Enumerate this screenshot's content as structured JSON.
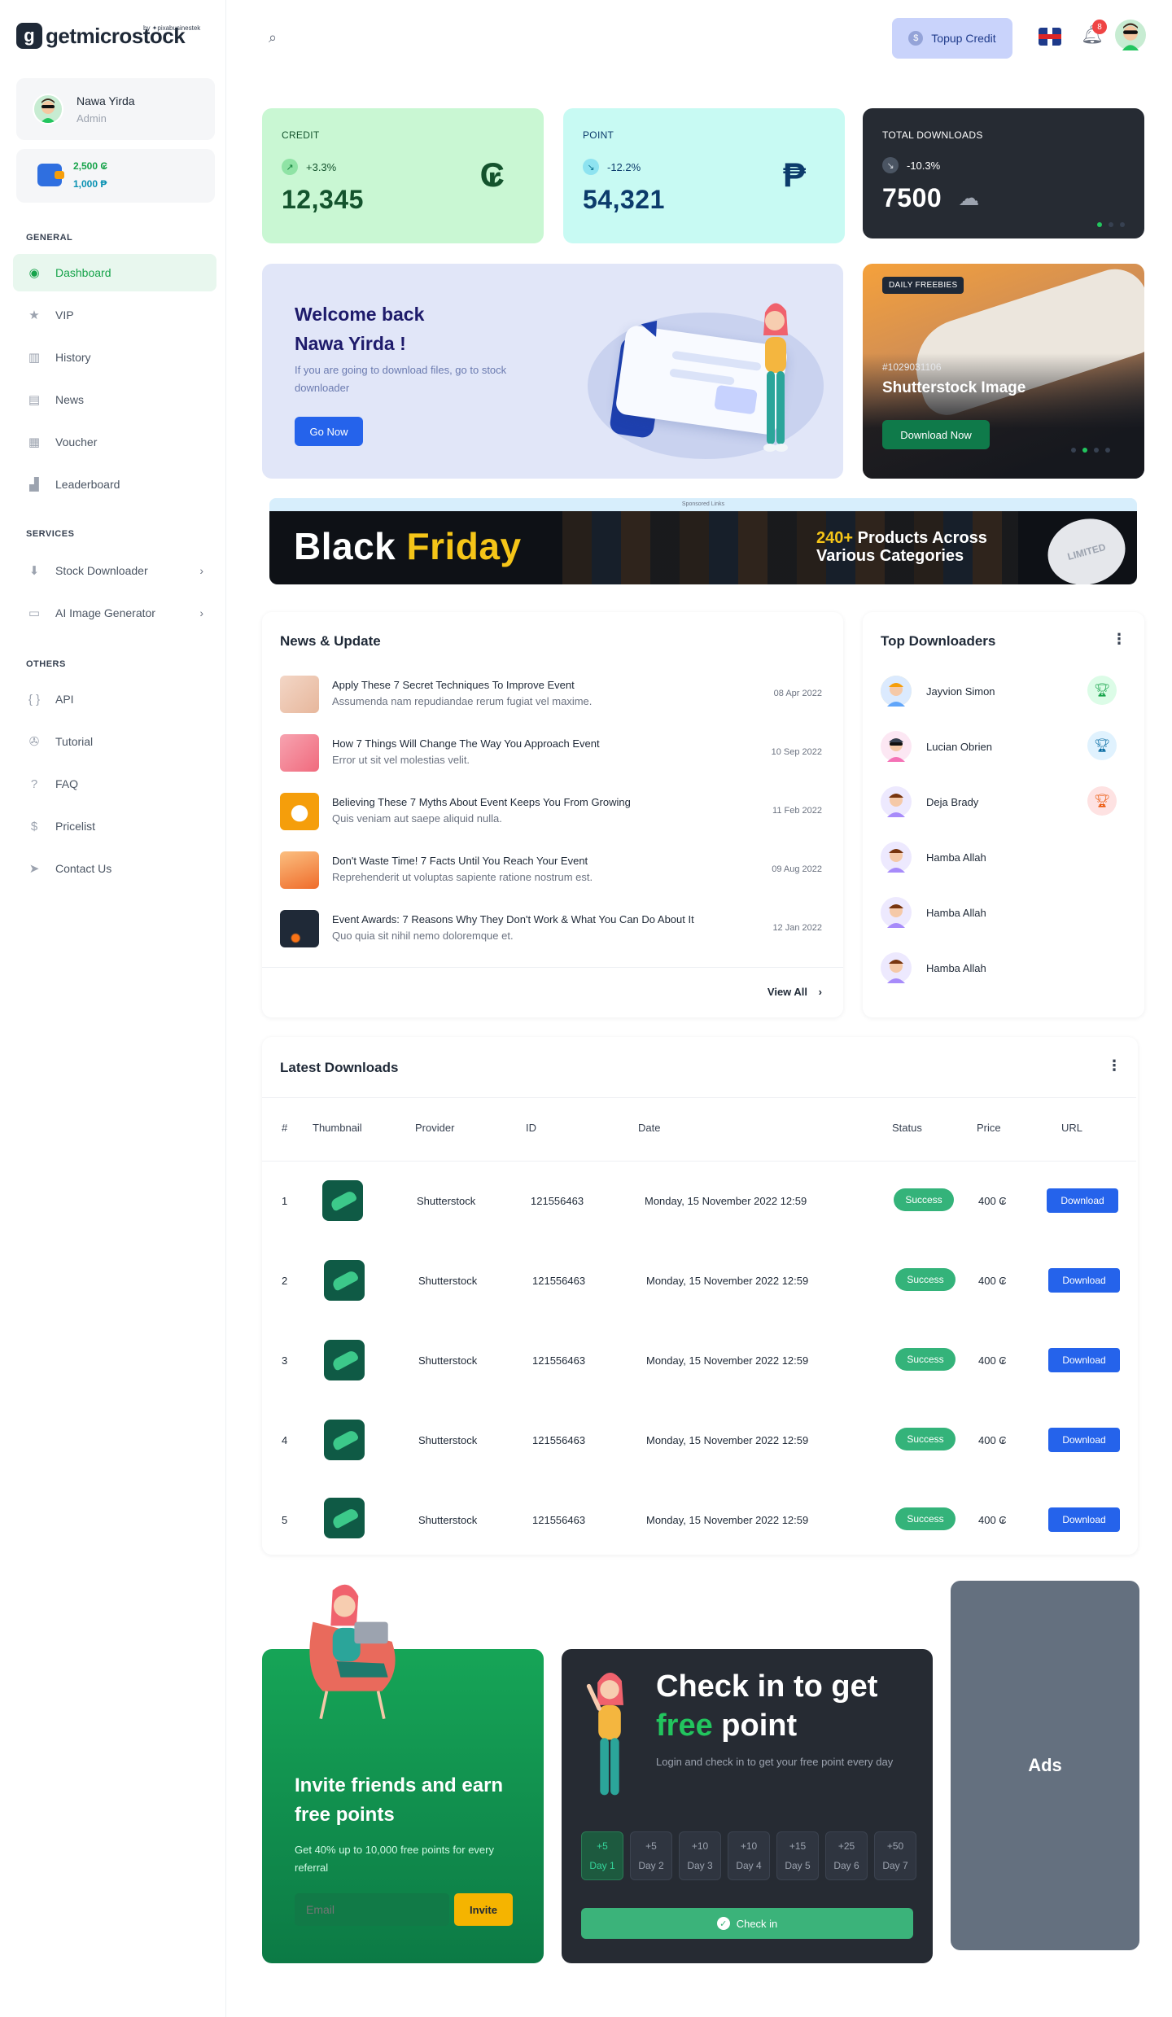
{
  "brand": {
    "name": "getmicrostock",
    "mark": "g",
    "by": "by ✦pixabusinestek"
  },
  "user": {
    "name": "Nawa Yirda",
    "role": "Admin"
  },
  "wallet": {
    "credit": "2,500 ₢",
    "point": "1,000 ₱"
  },
  "sidebar": {
    "general_heading": "GENERAL",
    "general": [
      {
        "label": "Dashboard",
        "icon": "dashboard-icon",
        "active": true
      },
      {
        "label": "VIP",
        "icon": "star-icon"
      },
      {
        "label": "History",
        "icon": "chart-icon"
      },
      {
        "label": "News",
        "icon": "document-icon"
      },
      {
        "label": "Voucher",
        "icon": "ticket-icon"
      },
      {
        "label": "Leaderboard",
        "icon": "podium-icon"
      }
    ],
    "services_heading": "SERVICES",
    "services": [
      {
        "label": "Stock Downloader",
        "icon": "download-icon"
      },
      {
        "label": "AI Image Generator",
        "icon": "image-icon"
      }
    ],
    "others_heading": "OTHERS",
    "others": [
      {
        "label": "API",
        "icon": "braces-icon"
      },
      {
        "label": "Tutorial",
        "icon": "film-icon"
      },
      {
        "label": "FAQ",
        "icon": "question-icon"
      },
      {
        "label": "Pricelist",
        "icon": "price-icon"
      },
      {
        "label": "Contact Us",
        "icon": "send-icon"
      }
    ]
  },
  "header": {
    "topup_label": "Topup Credit",
    "notification_count": "8"
  },
  "stats": [
    {
      "label": "CREDIT",
      "change": "+3.3%",
      "value": "12,345",
      "symbol": "₢"
    },
    {
      "label": "POINT",
      "change": "-12.2%",
      "value": "54,321",
      "symbol": "₱"
    },
    {
      "label": "TOTAL DOWNLOADS",
      "change": "-10.3%",
      "value": "7500"
    }
  ],
  "welcome": {
    "line1": "Welcome back",
    "line2": "Nawa Yirda !",
    "text": "If you are going to download files, go to stock downloader",
    "button": "Go Now"
  },
  "promo": {
    "badge": "DAILY FREEBIES",
    "id": "#1029031106",
    "title": "Shutterstock Image",
    "button": "Download Now"
  },
  "banner": {
    "sponsored": "Sponsored Links",
    "title_a": "Black ",
    "title_b": "Friday",
    "sub_a": "240+",
    "sub_b": " Products Across",
    "sub_c": "Various Categories",
    "seal": "LIMITED"
  },
  "news": {
    "title": "News & Update",
    "items": [
      {
        "title": "Apply These 7 Secret Techniques To Improve Event",
        "sub": "Assumenda nam repudiandae rerum fugiat vel maxime.",
        "date": "08 Apr 2022"
      },
      {
        "title": "How 7 Things Will Change The Way You Approach Event",
        "sub": "Error ut sit vel molestias velit.",
        "date": "10 Sep 2022"
      },
      {
        "title": "Believing These 7 Myths About Event Keeps You From Growing",
        "sub": "Quis veniam aut saepe aliquid nulla.",
        "date": "11 Feb 2022"
      },
      {
        "title": "Don't Waste Time! 7 Facts Until You Reach Your Event",
        "sub": "Reprehenderit ut voluptas sapiente ratione nostrum est.",
        "date": "09 Aug 2022"
      },
      {
        "title": "Event Awards: 7 Reasons Why They Don't Work & What You Can Do About It",
        "sub": "Quo quia sit nihil nemo doloremque et.",
        "date": "12 Jan 2022"
      }
    ],
    "view_all": "View All"
  },
  "top_downloaders": {
    "title": "Top Downloaders",
    "items": [
      {
        "name": "Jayvion Simon"
      },
      {
        "name": "Lucian Obrien"
      },
      {
        "name": "Deja Brady"
      },
      {
        "name": "Hamba Allah"
      },
      {
        "name": "Hamba Allah"
      },
      {
        "name": "Hamba Allah"
      }
    ]
  },
  "latest": {
    "title": "Latest Downloads",
    "columns": [
      "#",
      "Thumbnail",
      "Provider",
      "ID",
      "Date",
      "Status",
      "Price",
      "URL"
    ],
    "rows": [
      {
        "no": "1",
        "provider": "Shutterstock",
        "id": "121556463",
        "date": "Monday, 15 November 2022 12:59",
        "status": "Success",
        "price": "400 ₢",
        "url": "Download"
      },
      {
        "no": "2",
        "provider": "Shutterstock",
        "id": "121556463",
        "date": "Monday, 15 November 2022 12:59",
        "status": "Success",
        "price": "400 ₢",
        "url": "Download"
      },
      {
        "no": "3",
        "provider": "Shutterstock",
        "id": "121556463",
        "date": "Monday, 15 November 2022 12:59",
        "status": "Success",
        "price": "400 ₢",
        "url": "Download"
      },
      {
        "no": "4",
        "provider": "Shutterstock",
        "id": "121556463",
        "date": "Monday, 15 November 2022 12:59",
        "status": "Success",
        "price": "400 ₢",
        "url": "Download"
      },
      {
        "no": "5",
        "provider": "Shutterstock",
        "id": "121556463",
        "date": "Monday, 15 November 2022 12:59",
        "status": "Success",
        "price": "400 ₢",
        "url": "Download"
      }
    ]
  },
  "invite": {
    "title": "Invite friends and earn free points",
    "text": "Get 40% up to 10,000 free points for every referral",
    "placeholder": "Email",
    "button": "Invite"
  },
  "checkin": {
    "title_a": "Check in to get ",
    "title_b": "free",
    "title_c": " point",
    "text": "Login and check in to get your free point every day",
    "days": [
      {
        "pts": "+5",
        "day": "Day 1",
        "done": true
      },
      {
        "pts": "+5",
        "day": "Day 2"
      },
      {
        "pts": "+10",
        "day": "Day 3"
      },
      {
        "pts": "+10",
        "day": "Day 4"
      },
      {
        "pts": "+15",
        "day": "Day 5"
      },
      {
        "pts": "+25",
        "day": "Day 6"
      },
      {
        "pts": "+50",
        "day": "Day 7"
      }
    ],
    "button": "Check in"
  },
  "ads": {
    "label": "Ads"
  }
}
